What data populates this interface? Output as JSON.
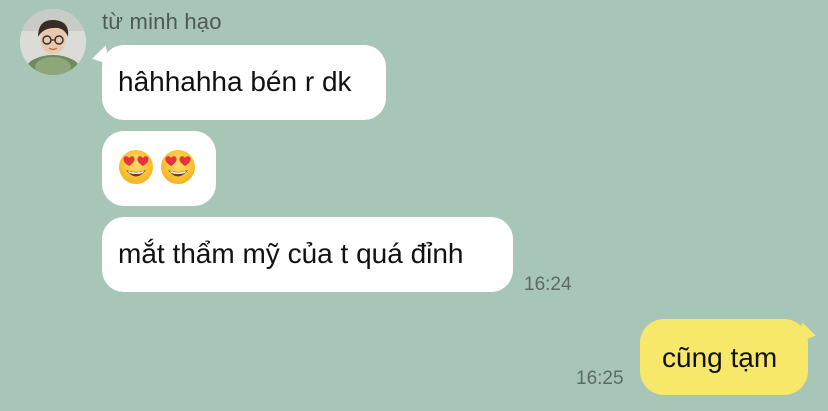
{
  "chat": {
    "background_color": "#a8c6b8",
    "incoming_bubble_color": "#ffffff",
    "outgoing_bubble_color": "#f8e86a",
    "sender": {
      "name": "từ minh hạo",
      "avatar_icon": "profile-photo"
    },
    "incoming": [
      {
        "text": "hâhhahha bén r dk"
      },
      {
        "emojis": [
          "😍",
          "😍"
        ],
        "emoji_icon": "heart-eyes-emoji"
      },
      {
        "text": "mắt thẩm mỹ của t quá đỉnh",
        "time": "16:24"
      }
    ],
    "outgoing": [
      {
        "text": "cũng tạm",
        "time": "16:25"
      }
    ]
  }
}
